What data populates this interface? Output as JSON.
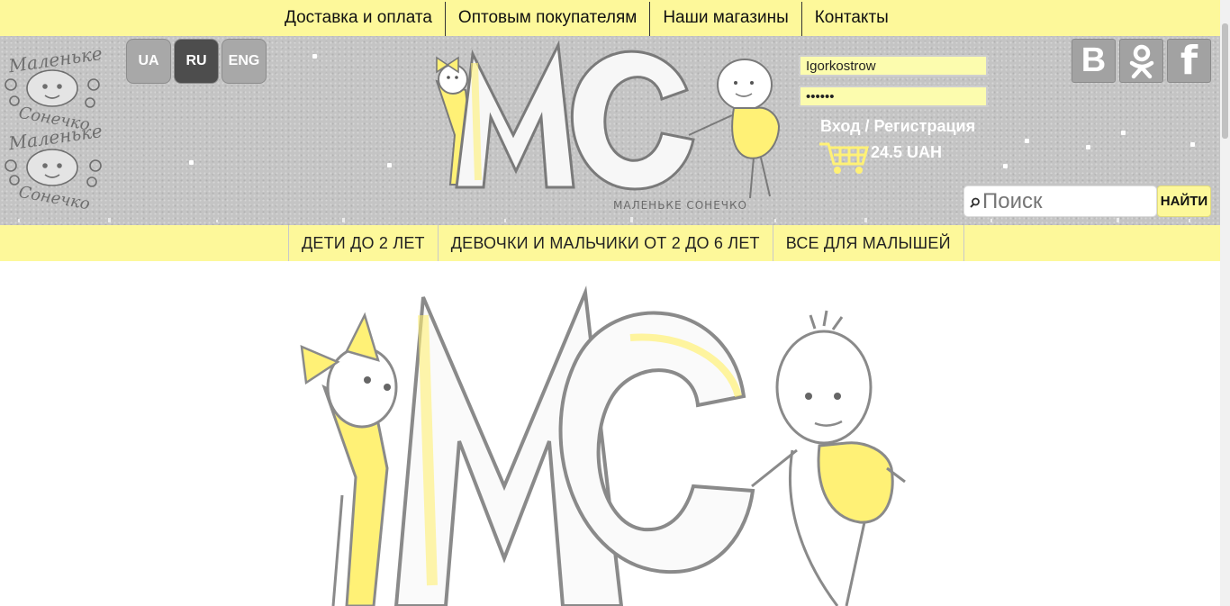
{
  "top_nav": {
    "items": [
      "Доставка и оплата",
      "Оптовым покупателям",
      "Наши магазины",
      "Контакты"
    ]
  },
  "header": {
    "languages": [
      {
        "label": "UA",
        "active": false
      },
      {
        "label": "RU",
        "active": true
      },
      {
        "label": "ENG",
        "active": false
      }
    ],
    "login": {
      "username_value": "Igorkostrow",
      "password_value": "••••••",
      "login_link": "Вход / Регистрация"
    },
    "cart": {
      "total": "24.5 UAH",
      "icon": "shopping-cart-icon"
    },
    "social": [
      {
        "name": "vk",
        "label": "В"
      },
      {
        "name": "odnoklassniki",
        "label": "ok"
      },
      {
        "name": "facebook",
        "label": "f"
      }
    ],
    "search": {
      "placeholder": "Поиск",
      "button_label": "НАЙТИ"
    },
    "logo_caption": "МАЛЕНЬКЕ СОНЕЧКО",
    "left_logo_text": [
      "Маленьке",
      "Сонечко"
    ]
  },
  "category_nav": {
    "items": [
      "ДЕТИ ДО 2 ЛЕТ",
      "ДЕВОЧКИ И МАЛЬЧИКИ ОТ 2 ДО 6 ЛЕТ",
      "ВСЕ ДЛЯ МАЛЫШЕЙ"
    ]
  },
  "colors": {
    "accent_yellow": "#fdf89a",
    "header_gray": "#c4c4c4",
    "drawing_gray": "#8a8a8a",
    "drawing_yellow": "#fff176"
  }
}
